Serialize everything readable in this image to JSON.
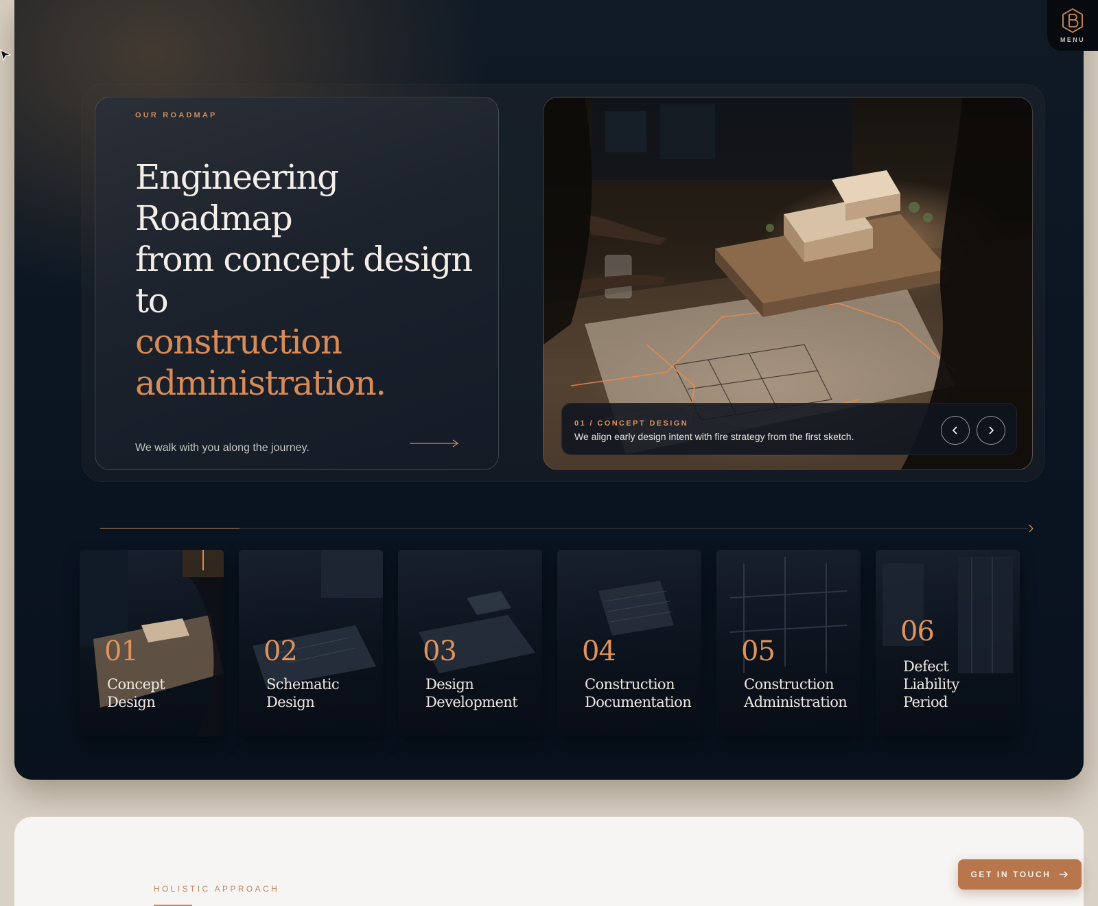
{
  "brand": {
    "menu_label": "MENU",
    "logo_icon": "hexagon-b-logo-icon"
  },
  "roadmap": {
    "eyebrow": "OUR ROADMAP",
    "headline": {
      "line1": "Engineering",
      "line2": "Roadmap",
      "line3": "from concept design",
      "line4": "to",
      "accent1": "construction",
      "accent2": "administration."
    },
    "subtitle": "We walk with you along the journey.",
    "accent_color": "#d98b57"
  },
  "slider": {
    "eyebrow": "01 / CONCEPT DESIGN",
    "text": "We align early design intent with fire strategy from the first sketch.",
    "progress_fraction": 0.15
  },
  "stages": [
    {
      "num": "01",
      "title1": "Concept",
      "title2": "Design",
      "title3": ""
    },
    {
      "num": "02",
      "title1": "Schematic",
      "title2": "Design",
      "title3": ""
    },
    {
      "num": "03",
      "title1": "Design",
      "title2": "Development",
      "title3": ""
    },
    {
      "num": "04",
      "title1": "Construction",
      "title2": "Documentation",
      "title3": ""
    },
    {
      "num": "05",
      "title1": "Construction",
      "title2": "Administration",
      "title3": ""
    },
    {
      "num": "06",
      "title1": "Defect",
      "title2": "Liability",
      "title3": "Period"
    }
  ],
  "holistic": {
    "eyebrow": "HOLISTIC APPROACH"
  },
  "cta": {
    "label": "GET IN TOUCH"
  }
}
